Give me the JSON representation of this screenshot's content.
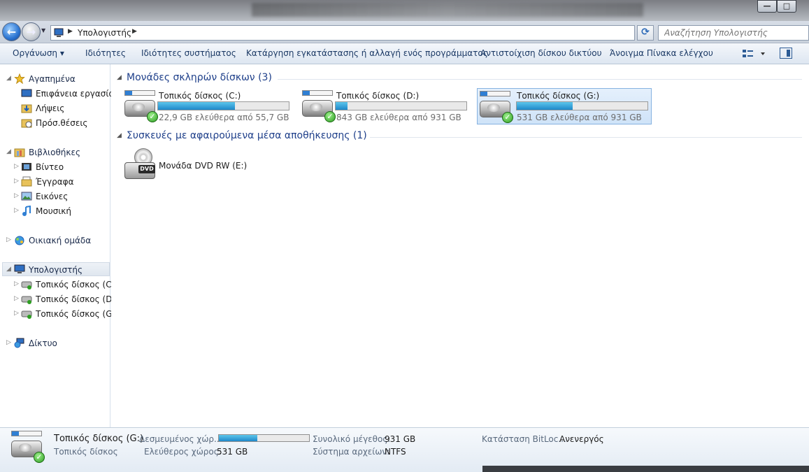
{
  "window": {
    "minimize_glyph": "—",
    "maximize_glyph": "□"
  },
  "address": {
    "crumb": "Υπολογιστής",
    "search_placeholder": "Αναζήτηση Υπολογιστής"
  },
  "toolbar": {
    "organize": "Οργάνωση ▾",
    "properties": "Ιδιότητες",
    "system_properties": "Ιδιότητες συστήματος",
    "uninstall": "Κατάργηση εγκατάστασης ή αλλαγή ενός προγράμματος",
    "map_drive": "Αντιστοίχιση δίσκου δικτύου",
    "control_panel": "Άνοιγμα Πίνακα ελέγχου"
  },
  "nav": {
    "favorites": "Αγαπημένα",
    "desktop": "Επιφάνεια εργασίας",
    "downloads": "Λήψεις",
    "recent": "Πρόσ.θέσεις",
    "libraries": "Βιβλιοθήκες",
    "videos": "Βίντεο",
    "documents": "Έγγραφα",
    "pictures": "Εικόνες",
    "music": "Μουσική",
    "homegroup": "Οικιακή ομάδα",
    "computer": "Υπολογιστής",
    "drive_c": "Τοπικός δίσκος (C:)",
    "drive_d": "Τοπικός δίσκος (D:)",
    "drive_g": "Τοπικός δίσκος (G:)",
    "network": "Δίκτυο"
  },
  "groups": {
    "hdd": "Μονάδες σκληρών δίσκων (3)",
    "removable": "Συσκευές με αφαιρούμενα μέσα αποθήκευσης (1)"
  },
  "drives": [
    {
      "name": "Τοπικός δίσκος (C:)",
      "free_text": "22,9 GB ελεύθερα από 55,7 GB",
      "used_fraction": 0.59,
      "selected": false
    },
    {
      "name": "Τοπικός δίσκος (D:)",
      "free_text": "843 GB ελεύθερα από 931 GB",
      "used_fraction": 0.09,
      "selected": false
    },
    {
      "name": "Τοπικός δίσκος (G:)",
      "free_text": "531 GB ελεύθερα από 931 GB",
      "used_fraction": 0.43,
      "selected": true
    }
  ],
  "dvd": {
    "name": "Μονάδα DVD RW (E:)",
    "badge": "DVD"
  },
  "details": {
    "title": "Τοπικός δίσκος (G:)",
    "type": "Τοπικός δίσκος",
    "used_label": "Δεσμευμένος χώρ...",
    "used_fraction": 0.43,
    "free_label": "Ελεύθερος χώρος:",
    "free_value": "531 GB",
    "total_label": "Συνολικό μέγεθος:",
    "total_value": "931 GB",
    "fs_label": "Σύστημα αρχείων:",
    "fs_value": "NTFS",
    "bitlocker_label": "Κατάσταση BitLoc...",
    "bitlocker_value": "Ανενεργός"
  },
  "colors": {
    "accent": "#1e3f8a",
    "bar": "#1f88c9",
    "ok": "#2e9e22"
  }
}
